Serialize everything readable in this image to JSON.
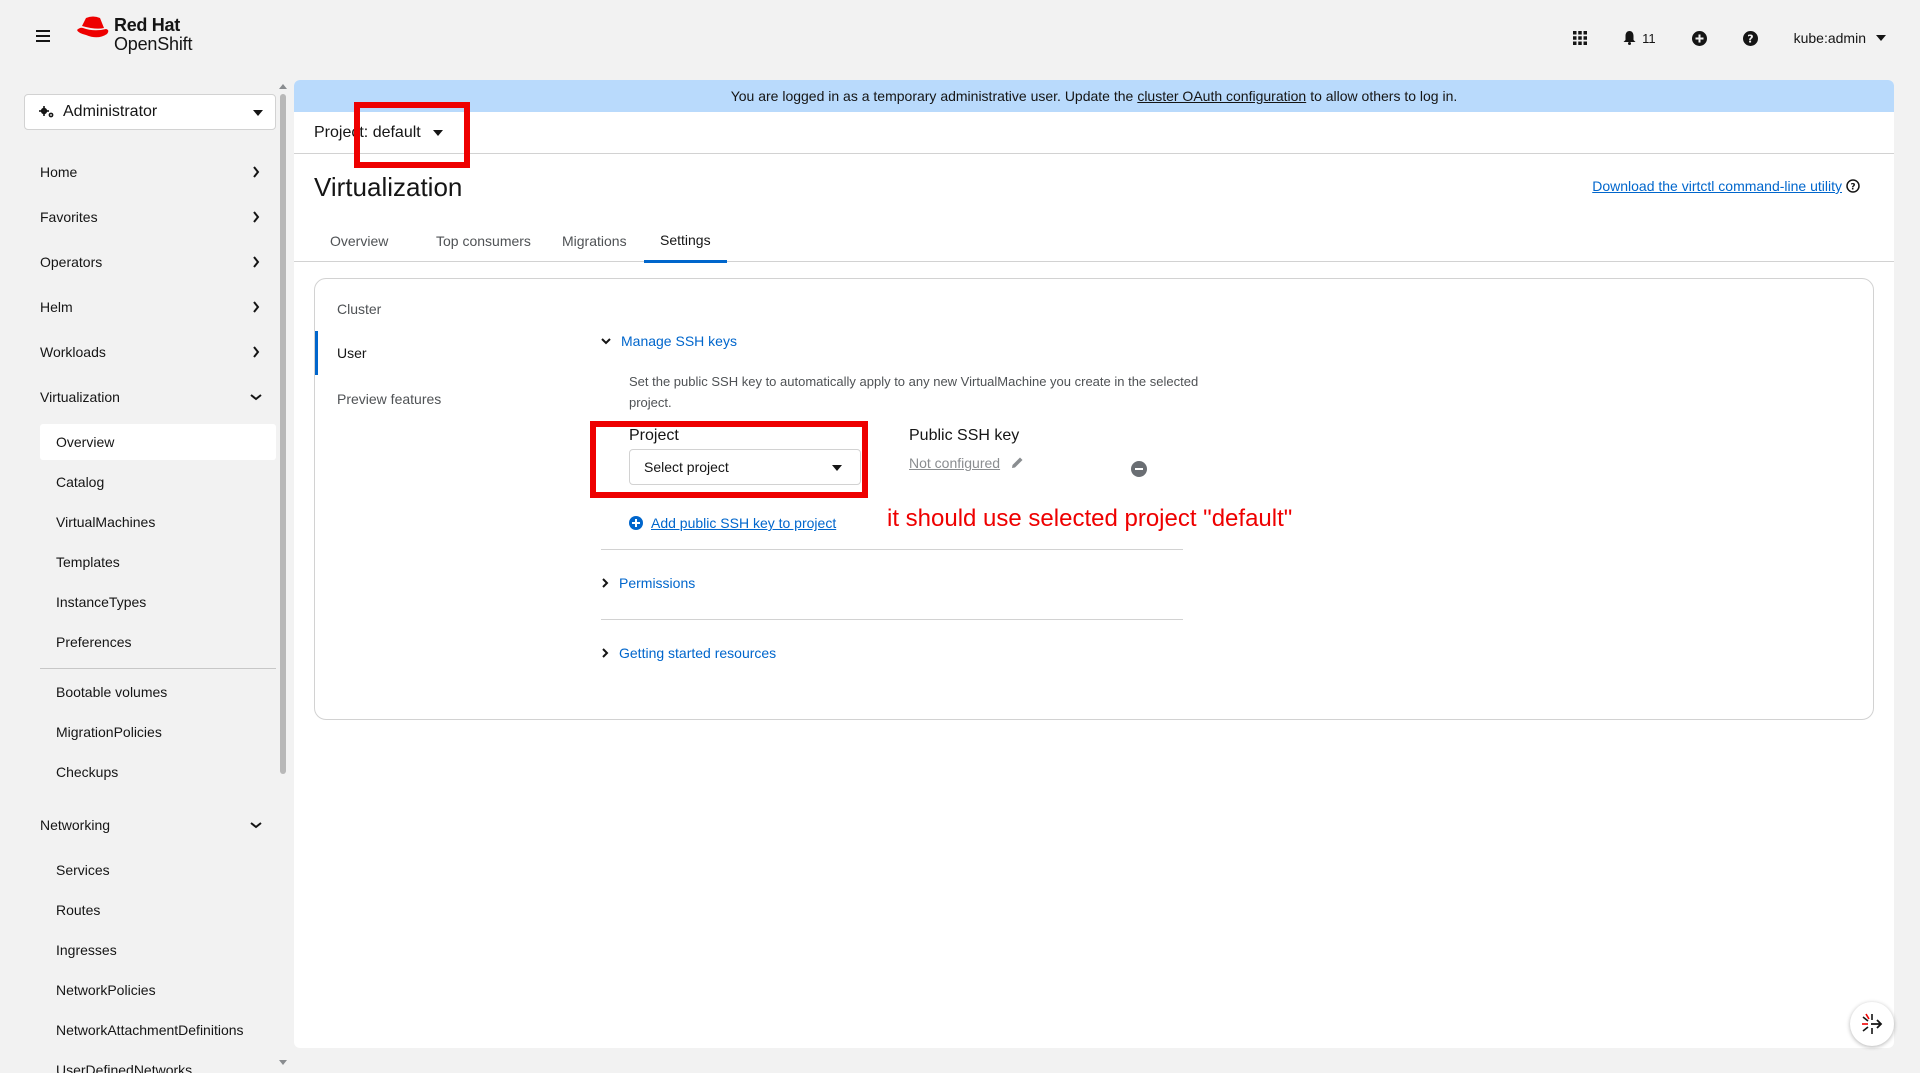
{
  "masthead": {
    "logo_line1": "Red Hat",
    "logo_line2": "OpenShift",
    "notification_count": "11",
    "user": "kube:admin",
    "icons": [
      "hamburger-icon",
      "app-launcher-icon",
      "bell-icon",
      "plus-circle-icon",
      "help-icon"
    ]
  },
  "sidebar": {
    "perspective": "Administrator",
    "sections": [
      {
        "label": "Home"
      },
      {
        "label": "Favorites"
      },
      {
        "label": "Operators"
      },
      {
        "label": "Helm"
      },
      {
        "label": "Workloads"
      },
      {
        "label": "Virtualization"
      },
      {
        "label": "Networking"
      }
    ],
    "virtualization_items": [
      "Overview",
      "Catalog",
      "VirtualMachines",
      "Templates",
      "InstanceTypes",
      "Preferences",
      "Bootable volumes",
      "MigrationPolicies",
      "Checkups"
    ],
    "networking_items": [
      "Services",
      "Routes",
      "Ingresses",
      "NetworkPolicies",
      "NetworkAttachmentDefinitions",
      "UserDefinedNetworks"
    ]
  },
  "banner": {
    "text_before": "You are logged in as a temporary administrative user. Update the",
    "link": "cluster OAuth configuration",
    "text_after": "to allow others to log in."
  },
  "project_selector": {
    "label": "Project: default"
  },
  "page": {
    "title": "Virtualization",
    "download_link": "Download the virtctl command-line utility",
    "tabs": [
      "Overview",
      "Top consumers",
      "Migrations",
      "Settings"
    ]
  },
  "settings": {
    "nav": [
      "Cluster",
      "User",
      "Preview features"
    ],
    "manage_ssh": "Manage SSH keys",
    "description": "Set the public SSH key to automatically apply to any new VirtualMachine you create in the selected project.",
    "project_label": "Project",
    "select_placeholder": "Select project",
    "public_key_label": "Public SSH key",
    "not_configured": "Not configured",
    "add_key": "Add public SSH key to project",
    "permissions": "Permissions",
    "getting_started": "Getting started resources"
  },
  "annotation": {
    "text": "it should use selected project \"default\"",
    "color": "#ee0000"
  },
  "colors": {
    "accent": "#0066cc",
    "banner": "#b9dafc",
    "logo_red": "#ee0000"
  }
}
